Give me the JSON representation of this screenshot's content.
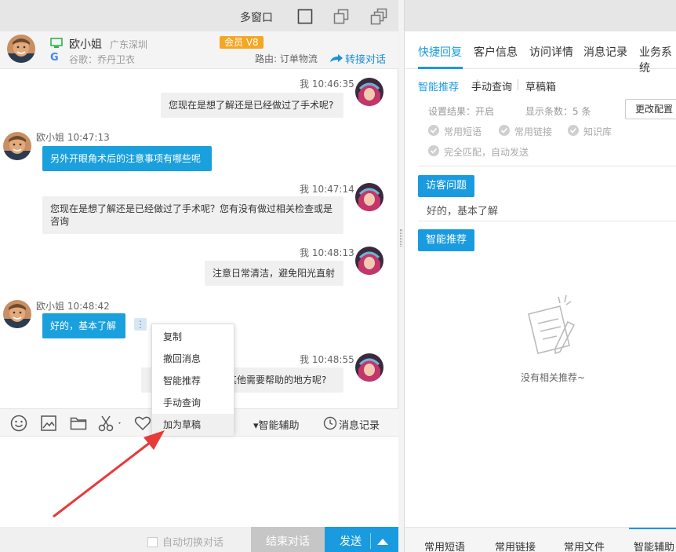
{
  "titlebar": {
    "multi_window": "多窗口"
  },
  "customer": {
    "name": "欧小姐",
    "location": "广东深圳",
    "source": "谷歌：乔丹卫衣",
    "vip_label": "会员 V8",
    "route": "路由: 订单物流",
    "transfer": "转接对话"
  },
  "messages": [
    {
      "dir": "out",
      "meta": "我 10:46:35",
      "text": "您现在是想了解还是已经做过了手术呢?"
    },
    {
      "dir": "in",
      "meta": "欧小姐 10:47:13",
      "text": "另外开眼角术后的注意事项有哪些呢"
    },
    {
      "dir": "out",
      "meta": "我 10:47:14",
      "text": "您现在是想了解还是已经做过了手术呢？您有没有做过相关检查或是咨询"
    },
    {
      "dir": "out",
      "meta": "我 10:48:13",
      "text": "注意日常清洁，避免阳光直射"
    },
    {
      "dir": "in",
      "meta": "欧小姐 10:48:42",
      "text": "好的，基本了解"
    },
    {
      "dir": "out",
      "meta": "我 10:48:55",
      "text": "其他需要帮助的地方呢?"
    }
  ],
  "context_menu": [
    "复制",
    "撤回消息",
    "智能推荐",
    "手动查询",
    "加为草稿"
  ],
  "toolbar": {
    "smart_assist": "▾智能辅助",
    "history": "消息记录"
  },
  "bottom": {
    "auto_switch": "自动切换对话",
    "end": "结束对话",
    "send": "发送"
  },
  "right": {
    "tabs": [
      "快捷回复",
      "客户信息",
      "访问详情",
      "消息记录",
      "业务系统"
    ],
    "subtabs": [
      "智能推荐",
      "手动查询",
      "草稿箱"
    ],
    "setting_result": "设置结果：开启",
    "display_count": "显示条数：5  条",
    "change_config": "更改配置",
    "options": [
      "常用短语",
      "常用链接",
      "知识库",
      "完全匹配，自动发送"
    ],
    "visitor_question_btn": "访客问题",
    "visitor_question": "好的，基本了解",
    "smart_btn": "智能推荐",
    "empty": "没有相关推荐~",
    "bottom_tabs": [
      "常用短语",
      "常用链接",
      "常用文件",
      "智能辅助"
    ]
  },
  "colors": {
    "accent": "#1a9be0",
    "vip": "#f5a623",
    "arrow": "#e63b3b"
  }
}
